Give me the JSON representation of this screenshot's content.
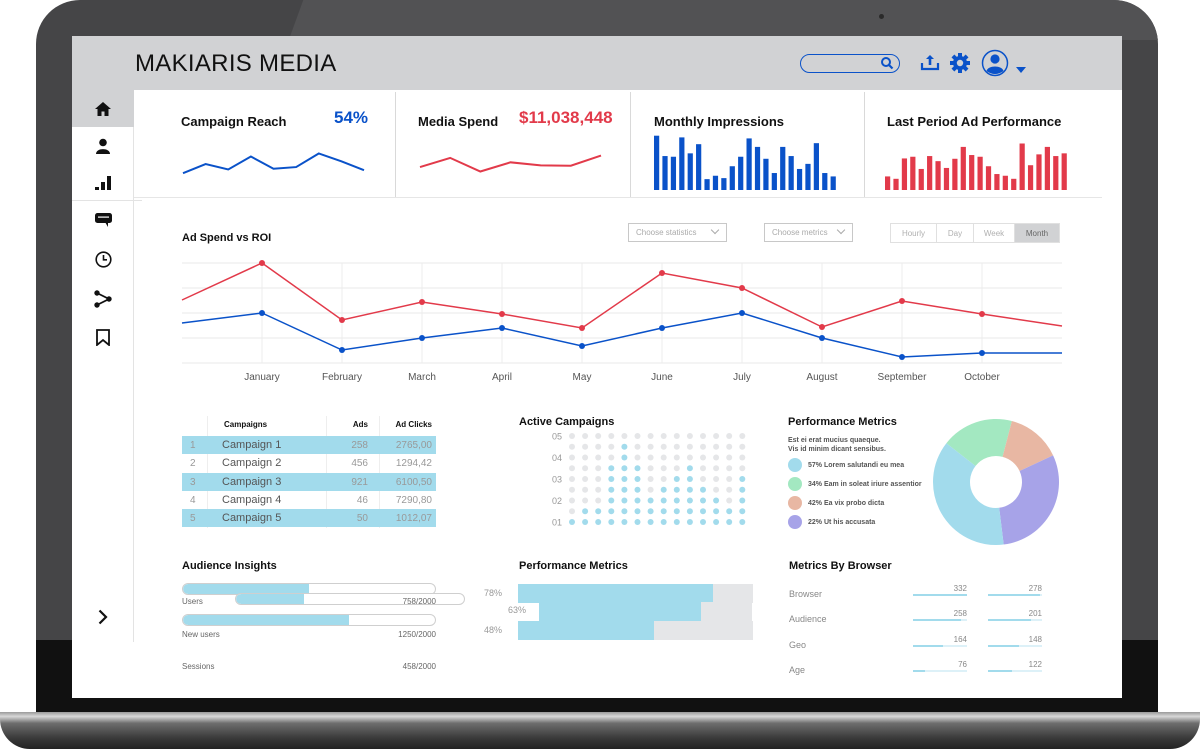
{
  "app": {
    "title": "MAKIARIS MEDIA",
    "search_placeholder": "",
    "toolbar_icons": [
      "search-icon",
      "upload-icon",
      "gear-icon",
      "user-avatar-icon",
      "caret-down-icon"
    ]
  },
  "sidebar": {
    "items": [
      {
        "icon": "home-icon",
        "active": true
      },
      {
        "icon": "user-icon",
        "active": false
      },
      {
        "icon": "bar-signal-icon",
        "active": false
      },
      {
        "icon": "comment-icon",
        "active": false
      },
      {
        "icon": "clock-icon",
        "active": false
      },
      {
        "icon": "share-icon",
        "active": false
      },
      {
        "icon": "bookmark-icon",
        "active": false
      }
    ],
    "expand_icon": "chevron-right-icon"
  },
  "kpis": [
    {
      "title": "Campaign Reach",
      "value": "54%",
      "color": "#0a52c9",
      "type": "line",
      "points": [
        20,
        47,
        31,
        69,
        33,
        38,
        78,
        55,
        29
      ]
    },
    {
      "title": "Media Spend",
      "value": "$11,038,448",
      "color": "#e23a4a",
      "type": "line",
      "points": [
        38,
        65,
        25,
        52,
        43,
        42,
        72
      ]
    },
    {
      "title": "Monthly Impressions",
      "value": "",
      "color": "#0a52c9",
      "type": "bar",
      "points": [
        160,
        100,
        98,
        155,
        108,
        135,
        32,
        42,
        35,
        70,
        98,
        152,
        127,
        92,
        50,
        127,
        100,
        62,
        77,
        138,
        50,
        40
      ]
    },
    {
      "title": "Last Period Ad Performance",
      "value": "",
      "color": "#e23a4a",
      "type": "bar",
      "points": [
        40,
        33,
        93,
        98,
        62,
        100,
        85,
        65,
        92,
        127,
        103,
        98,
        70,
        47,
        42,
        33,
        137,
        73,
        105,
        127,
        100,
        108
      ]
    }
  ],
  "ad_spend": {
    "title": "Ad Spend vs ROI",
    "select_statistics": "Choose statistics",
    "select_metrics": "Choose metrics",
    "periods": [
      {
        "label": "Hourly",
        "active": false
      },
      {
        "label": "Day",
        "active": false
      },
      {
        "label": "Week",
        "active": false
      },
      {
        "label": "Month",
        "active": true
      }
    ]
  },
  "chart_data": {
    "type": "line",
    "title": "Ad Spend vs ROI",
    "xlabel": "",
    "ylabel": "",
    "categories": [
      "January",
      "February",
      "March",
      "April",
      "May",
      "June",
      "July",
      "August",
      "September",
      "October"
    ],
    "ylim": [
      0,
      100
    ],
    "grid": true,
    "legend": "none",
    "series": [
      {
        "name": "Ad Spend",
        "color": "#e23a4a",
        "lead_in": 63,
        "values": [
          100,
          43,
          61,
          49,
          35,
          90,
          75,
          36,
          62,
          49
        ],
        "lead_out": 37
      },
      {
        "name": "ROI",
        "color": "#0a52c9",
        "lead_in": 40,
        "values": [
          50,
          13,
          25,
          35,
          17,
          35,
          50,
          25,
          6,
          10
        ],
        "lead_out": 10
      }
    ]
  },
  "campaigns_table": {
    "headers": [
      "",
      "Campaigns",
      "Ads",
      "Ad Clicks"
    ],
    "rows": [
      {
        "idx": "1",
        "name": "Campaign 1",
        "ads": "258",
        "clicks": "2765,00"
      },
      {
        "idx": "2",
        "name": "Campaign 2",
        "ads": "456",
        "clicks": "1294,42"
      },
      {
        "idx": "3",
        "name": "Campaign 3",
        "ads": "921",
        "clicks": "6100,50"
      },
      {
        "idx": "4",
        "name": "Campaign 4",
        "ads": "46",
        "clicks": "7290,80"
      },
      {
        "idx": "5",
        "name": "Campaign 5",
        "ads": "50",
        "clicks": "1012,07"
      }
    ]
  },
  "active_campaigns": {
    "title": "Active Campaigns",
    "y_labels": [
      "05",
      "04",
      "03",
      "02",
      "01"
    ],
    "rows_total": 9,
    "column_levels": [
      1,
      2,
      2,
      6,
      8,
      6,
      3,
      4,
      5,
      6,
      4,
      3,
      2,
      5,
      3,
      3,
      1,
      1
    ],
    "filled_color": "#a2dbec",
    "empty_color": "#e5e6e8"
  },
  "performance_metrics_pie": {
    "title": "Performance Metrics",
    "subtitle_line1": "Est ei erat mucius quaeque.",
    "subtitle_line2": "Vis id minim dicant sensibus.",
    "legend": [
      {
        "label": "57% Lorem salutandi eu mea",
        "color": "#a2dbec"
      },
      {
        "label": "34% Eam in soleat iriure assentior",
        "color": "#a3e8c1"
      },
      {
        "label": "42% Ea vix probo dicta",
        "color": "#e8b7a3"
      },
      {
        "label": "22% Ut his accusata",
        "color": "#a7a3e8"
      }
    ],
    "slices": [
      {
        "name": "Lorem salutandi eu mea",
        "share": 0.375,
        "color": "#a2dbec"
      },
      {
        "name": "Eam in soleat iriure assentior",
        "share": 0.185,
        "color": "#a3e8c1"
      },
      {
        "name": "Ea vix probo dicta",
        "share": 0.14,
        "color": "#e8b7a3"
      },
      {
        "name": "Ut his accusata",
        "share": 0.3,
        "color": "#a7a3e8"
      }
    ]
  },
  "audience": {
    "title": "Audience Insights",
    "items": [
      {
        "label": "Users",
        "value": "758/2000",
        "fraction": 0.5
      },
      {
        "label": "New users",
        "value": "1250/2000",
        "fraction": 0.66
      },
      {
        "label": "Sessions",
        "value": "458/2000",
        "fraction": 0.3
      }
    ]
  },
  "performance_bars": {
    "title": "Performance Metrics",
    "items": [
      {
        "label": "78%",
        "fraction": 0.83
      },
      {
        "label": "63%",
        "fraction": 0.76
      },
      {
        "label": "48%",
        "fraction": 0.58
      }
    ]
  },
  "browser_metrics": {
    "title": "Metrics By Browser",
    "rows": [
      {
        "label": "Browser",
        "a": "332",
        "a_frac": 1.0,
        "b": "278",
        "b_frac": 0.97
      },
      {
        "label": "Audience",
        "a": "258",
        "a_frac": 0.88,
        "b": "201",
        "b_frac": 0.8
      },
      {
        "label": "Geo",
        "a": "164",
        "a_frac": 0.55,
        "b": "148",
        "b_frac": 0.58
      },
      {
        "label": "Age",
        "a": "76",
        "a_frac": 0.23,
        "b": "122",
        "b_frac": 0.45
      }
    ]
  }
}
